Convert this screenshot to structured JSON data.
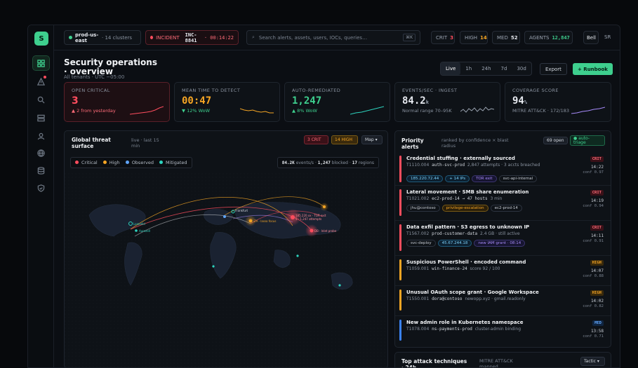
{
  "app": {
    "logo_letter": "S"
  },
  "sidebar": {
    "items": [
      "dashboard-icon",
      "alert-icon",
      "search-icon",
      "list-icon",
      "user-icon",
      "globe-icon",
      "database-icon",
      "shield-icon"
    ]
  },
  "topbar": {
    "env": "prod-us-east",
    "env_meta": "· 14 clusters",
    "incident_label": "INCIDENT",
    "incident_id": "INC-8841",
    "incident_timer": "· 00:14:22",
    "search_placeholder": "Search alerts, assets, users, IOCs, queries…",
    "search_kbd": "⌘K",
    "crit_label": "CRIT",
    "crit_value": "3",
    "high_label": "HIGH",
    "high_value": "14",
    "med_label": "MED",
    "med_value": "52",
    "agents_label": "AGENTS",
    "agents_value": "12,847",
    "bell_label": "Bell",
    "user_initials": "SR"
  },
  "header": {
    "title": "Security operations · overview",
    "subtitle": "All tenants · UTC −05:00",
    "ranges": [
      "Live",
      "1h",
      "24h",
      "7d",
      "30d"
    ],
    "selected_range": "Live",
    "export_label": "Export",
    "runbook_label": "+ Runbook"
  },
  "kpis": [
    {
      "label": "OPEN CRITICAL",
      "value": "3",
      "unit": "",
      "sub": "▲ 2 from yesterday"
    },
    {
      "label": "MEAN TIME TO DETECT",
      "value": "00:47",
      "unit": "",
      "sub": "▼ 12% WoW"
    },
    {
      "label": "AUTO-REMEDIATED",
      "value": "1,247",
      "unit": "",
      "sub": "▲ 8% WoW"
    },
    {
      "label": "EVENTS/SEC · INGEST",
      "value": "84.2",
      "unit": "k",
      "sub": "Normal range 70–95K"
    },
    {
      "label": "COVERAGE SCORE",
      "value": "94",
      "unit": "%",
      "sub": "MITRE ATT&CK · 172/183"
    }
  ],
  "map": {
    "title": "Global threat surface",
    "meta": "live · last 15 min",
    "tag_crit": "3 CRIT",
    "tag_high": "14 HIGH",
    "mode_label": "Map ▾",
    "legend": [
      "Critical",
      "High",
      "Observed",
      "Mitigated"
    ],
    "stats_eps": "84.2K",
    "stats_eps_unit": "events/s",
    "stats_blocked": "1,247",
    "stats_blocked_label": "blocked",
    "stats_regions": "17",
    "stats_regions_label": "regions",
    "labels": {
      "origin1": "Lorsveld",
      "origin2": "Aurezell",
      "hub1": "Frankfurt",
      "hub2": "ZA · lasso focus",
      "target1": "185.220.xx · TOR exit",
      "target1b": "5 · 1,247 attempts",
      "target2": "DB · Inlet probe"
    }
  },
  "alerts": {
    "title": "Priority alerts",
    "meta": "ranked by confidence × blast radius",
    "open_label": "69 open",
    "triage_label": "● auto-triage",
    "items": [
      {
        "title": "Credential stuffing · externally sourced",
        "id": "T1110.004",
        "asset": "auth-svc-prod",
        "meta": "2,847 attempts · 3 accts breached",
        "pills": [
          "185.220.72.44",
          "+ 14 IPs",
          "TOR exit",
          "svc-api-internal"
        ],
        "sev": "CRIT",
        "time": "14:22",
        "conf": "conf 0.97"
      },
      {
        "title": "Lateral movement · SMB share enumeration",
        "id": "T1021.002",
        "asset": "ec2-prod-14 → 47 hosts",
        "meta": "3 min",
        "pills": [
          "jhu@contoso",
          "privilege-escalation",
          "ec2-prod-14"
        ],
        "sev": "CRIT",
        "time": "14:19",
        "conf": "conf 0.94"
      },
      {
        "title": "Data exfil pattern · S3 egress to unknown IP",
        "id": "T1567.002",
        "asset": "prod-customer-data",
        "meta": "2.4 GB · still active",
        "pills": [
          "svc-deploy",
          "45.67.244.18",
          "new IAM grant · 08:14"
        ],
        "sev": "CRIT",
        "time": "14:11",
        "conf": "conf 0.91"
      },
      {
        "title": "Suspicious PowerShell · encoded command",
        "id": "T1059.001",
        "asset": "win-finance-24",
        "meta": "score 92 / 100",
        "pills": [],
        "sev": "HIGH",
        "time": "14:07",
        "conf": "conf 0.88"
      },
      {
        "title": "Unusual OAuth scope grant · Google Workspace",
        "id": "T1550.001",
        "asset": "dora@contoso",
        "meta": "newopp.xyz · gmail.readonly",
        "pills": [],
        "sev": "HIGH",
        "time": "14:02",
        "conf": "conf 0.82"
      },
      {
        "title": "New admin role in Kubernetes namespace",
        "id": "T1078.004",
        "asset": "ns-payments-prod",
        "meta": "cluster-admin binding",
        "pills": [],
        "sev": "MED",
        "time": "13:58",
        "conf": "conf 0.71"
      }
    ]
  },
  "techniques": {
    "title": "Top attack techniques · 24h",
    "meta": "MITRE ATT&CK mapped",
    "filter_label": "Tactic ▾"
  },
  "colors": {
    "crit": "#ff4d5e",
    "high": "#f5a524",
    "med": "#3b82f6",
    "ok": "#3ecf8e",
    "accent": "#3ecf8e",
    "teal": "#2dd4bf",
    "violet": "#a78bfa"
  }
}
